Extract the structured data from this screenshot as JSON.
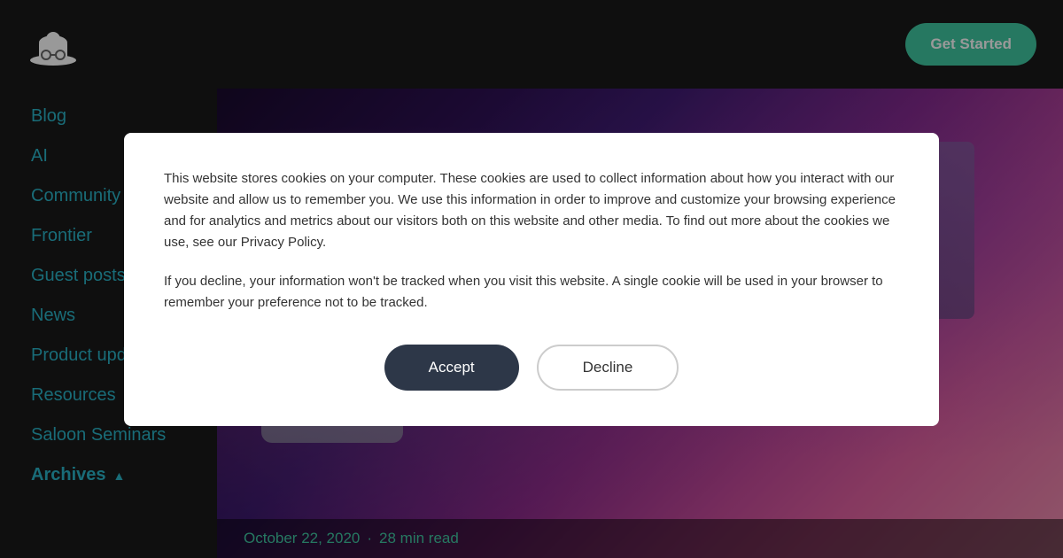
{
  "header": {
    "logo_alt": "Sheriff logo",
    "get_started_label": "Get Started"
  },
  "sidebar": {
    "items": [
      {
        "label": "Blog",
        "id": "blog"
      },
      {
        "label": "AI",
        "id": "ai"
      },
      {
        "label": "Community",
        "id": "community"
      },
      {
        "label": "Frontier",
        "id": "frontier"
      },
      {
        "label": "Guest posts",
        "id": "guest-posts"
      },
      {
        "label": "News",
        "id": "news"
      },
      {
        "label": "Product updates",
        "id": "product-updates"
      },
      {
        "label": "Resources",
        "id": "resources"
      },
      {
        "label": "Saloon Seminars",
        "id": "saloon-seminars"
      },
      {
        "label": "Archives",
        "id": "archives"
      }
    ]
  },
  "hero": {
    "date": "October 22, 2020",
    "separator": "·",
    "read_time": "28 min read"
  },
  "cookie": {
    "text1": "This website stores cookies on your computer. These cookies are used to collect information about how you interact with our website and allow us to remember you. We use this information in order to improve and customize your browsing experience and for analytics and metrics about our visitors both on this website and other media. To find out more about the cookies we use, see our Privacy Policy.",
    "text2": "If you decline, your information won't be tracked when you visit this website. A single cookie will be used in your browser to remember your preference not to be tracked.",
    "accept_label": "Accept",
    "decline_label": "Decline"
  }
}
